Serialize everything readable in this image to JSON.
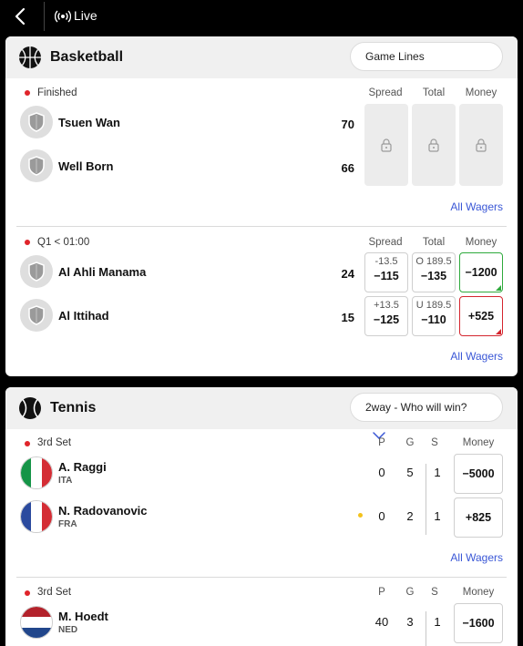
{
  "header": {
    "title": "Live"
  },
  "basketball": {
    "title": "Basketball",
    "market_selector": "Game Lines",
    "columns": [
      "Spread",
      "Total",
      "Money"
    ],
    "all_wagers": "All Wagers",
    "games": [
      {
        "status": "Finished",
        "teams": [
          {
            "name": "Tsuen Wan",
            "score": "70"
          },
          {
            "name": "Well Born",
            "score": "66"
          }
        ],
        "locked": true
      },
      {
        "status": "Q1 < 01:00",
        "teams": [
          {
            "name": "Al Ahli Manama",
            "score": "24",
            "spread_line": "-13.5",
            "spread_price": "−115",
            "total_line": "O 189.5",
            "total_price": "−135",
            "money": "−1200",
            "money_trend": "up"
          },
          {
            "name": "Al Ittihad",
            "score": "15",
            "spread_line": "+13.5",
            "spread_price": "−125",
            "total_line": "U 189.5",
            "total_price": "−110",
            "money": "+525",
            "money_trend": "down"
          }
        ]
      }
    ]
  },
  "tennis": {
    "title": "Tennis",
    "market_selector": "2way - Who will win?",
    "columns": [
      "P",
      "G",
      "S"
    ],
    "money_label": "Money",
    "all_wagers": "All Wagers",
    "matches": [
      {
        "status": "3rd Set",
        "players": [
          {
            "name": "A. Raggi",
            "country": "ITA",
            "points": "0",
            "games": "5",
            "sets": "1",
            "money": "−5000"
          },
          {
            "name": "N. Radovanovic",
            "country": "FRA",
            "points": "0",
            "games": "2",
            "sets": "1",
            "money": "+825",
            "serving": true
          }
        ]
      },
      {
        "status": "3rd Set",
        "players": [
          {
            "name": "M. Hoedt",
            "country": "NED",
            "points": "40",
            "games": "3",
            "sets": "1",
            "money": "−1600"
          }
        ]
      }
    ]
  },
  "colors": {
    "accent_link": "#3a57d6",
    "live_dot": "#e0242a",
    "odds_up": "#2eaa3c",
    "odds_down": "#d4252e",
    "serve_dot": "#f3c21c"
  }
}
